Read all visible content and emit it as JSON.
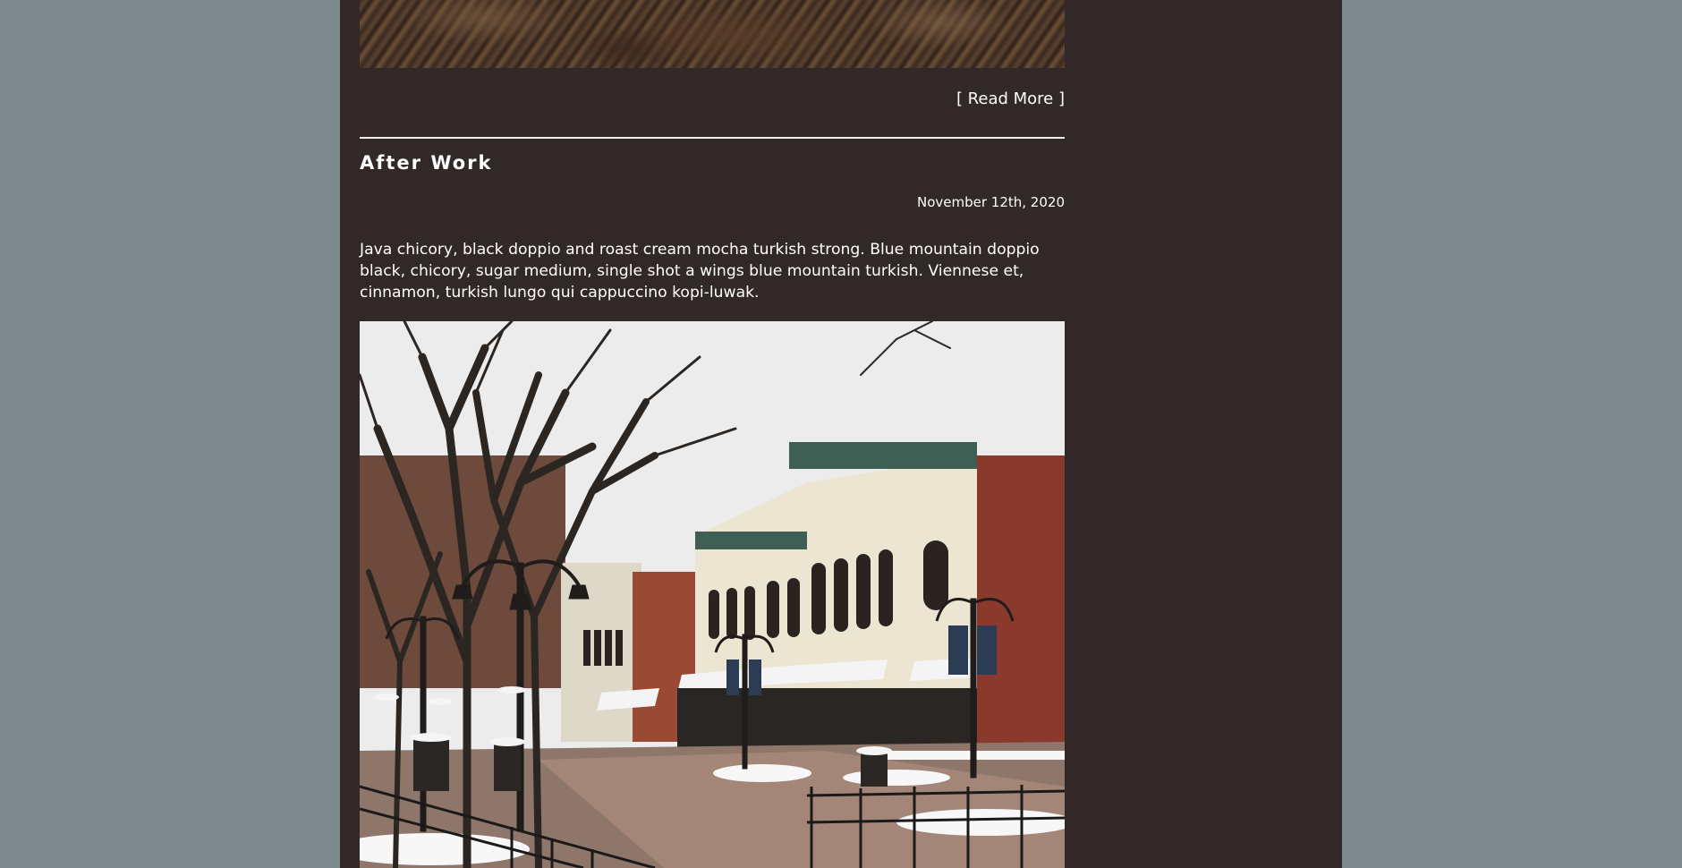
{
  "previous_post": {
    "read_more_label": "[ Read More ]"
  },
  "post": {
    "title": "After Work",
    "date": "November 12th, 2020",
    "body": "Java chicory, black doppio and roast cream mocha turkish strong. Blue mountain doppio black, chicory, sugar medium, single shot a wings blue mountain turkish. Viennese et, cinnamon, turkish lungo qui cappuccino kopi-luwak."
  },
  "colors": {
    "page_background": "#7c888a",
    "content_background": "#322828",
    "text": "#ffffff"
  }
}
